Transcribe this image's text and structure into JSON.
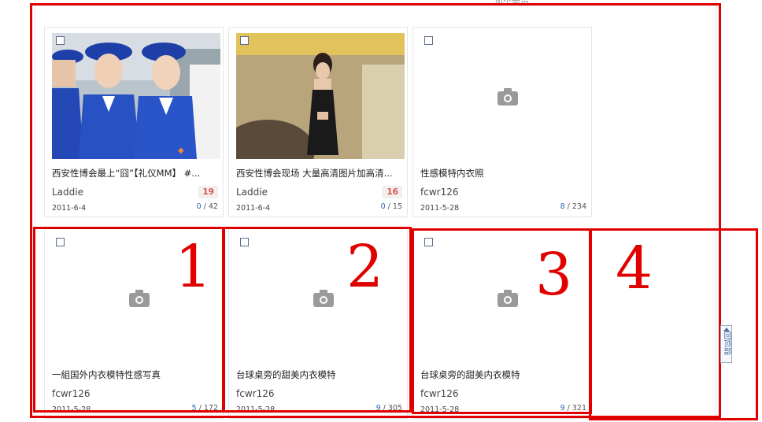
{
  "header": {
    "snippet": "加个会员"
  },
  "cards": [
    {
      "title": "西安性博会最上“囧”【礼仪MM】 #...",
      "author": "Laddie",
      "badge": "19",
      "date": "2011-6-4",
      "stats_a": "0",
      "stats_b": "42",
      "image": "photo-etiquette-girls"
    },
    {
      "title": "西安性博会现场 大量高清图片加高清...",
      "author": "Laddie",
      "badge": "16",
      "date": "2011-6-4",
      "stats_a": "0",
      "stats_b": "15",
      "image": "photo-lingerie-model"
    },
    {
      "title": "性感模特内衣照",
      "author": "fcwr126",
      "date": "2011-5-28",
      "stats_a": "8",
      "stats_b": "234",
      "image": "camera-icon"
    },
    {
      "title": "一組国外内衣模特性感写真",
      "author": "fcwr126",
      "date": "2011-5-28",
      "stats_a": "5",
      "stats_b": "172",
      "image": "camera-icon"
    },
    {
      "title": "台球桌旁的甜美内衣模特",
      "author": "fcwr126",
      "date": "2011-5-28",
      "stats_a": "9",
      "stats_b": "305",
      "image": "camera-icon"
    },
    {
      "title": "台球桌旁的甜美内衣模特",
      "author": "fcwr126",
      "date": "2011-5-28",
      "stats_a": "9",
      "stats_b": "321",
      "image": "camera-icon"
    }
  ],
  "annotations": [
    "1",
    "2",
    "3",
    "4"
  ],
  "back_to_top": "回顶部",
  "colors": {
    "annotation": "#e00000",
    "stat_link": "#2a64b4",
    "badge_text": "#d9534f"
  }
}
